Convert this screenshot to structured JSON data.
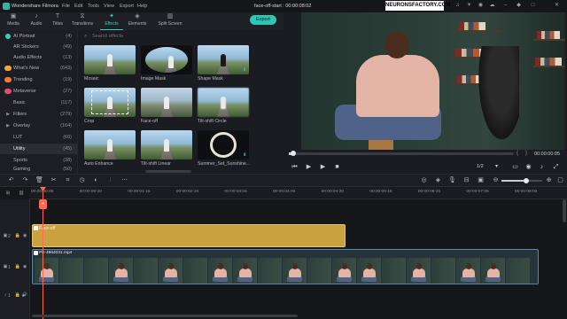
{
  "app": {
    "name": "Wondershare Filmora",
    "project_title": "face-off-start : 00:00:08:02",
    "menu": [
      "File",
      "Edit",
      "Tools",
      "View",
      "Export",
      "Help"
    ],
    "accent_color": "#2fd3c2"
  },
  "watermark": "NEURONSFACTORY.COM",
  "brand_mark": "NEURONS FACTORY",
  "tabs": [
    {
      "label": "Media",
      "icon": "media-icon"
    },
    {
      "label": "Audio",
      "icon": "audio-icon"
    },
    {
      "label": "Titles",
      "icon": "titles-icon"
    },
    {
      "label": "Transitions",
      "icon": "transitions-icon"
    },
    {
      "label": "Effects",
      "icon": "effects-icon",
      "active": true
    },
    {
      "label": "Elements",
      "icon": "elements-icon"
    },
    {
      "label": "Split Screen",
      "icon": "split-screen-icon"
    }
  ],
  "export_label": "Export",
  "sidebar": {
    "items": [
      {
        "label": "AI Portrait",
        "count": "(4)"
      },
      {
        "label": "AR Stickers",
        "count": "(49)"
      },
      {
        "label": "Audio Effects",
        "count": "(13)"
      },
      {
        "label": "What's New",
        "count": "(643)"
      },
      {
        "label": "Trending",
        "count": "(19)"
      },
      {
        "label": "Metaverse",
        "count": "(27)"
      },
      {
        "label": "Basic",
        "count": "(117)"
      },
      {
        "label": "Filters",
        "count": "(279)"
      },
      {
        "label": "Overlay",
        "count": "(164)"
      },
      {
        "label": "LUT",
        "count": "(66)"
      },
      {
        "label": "Utility",
        "count": "(45)",
        "selected": true
      },
      {
        "label": "Sports",
        "count": "(38)"
      },
      {
        "label": "Gaming",
        "count": "(50)"
      }
    ]
  },
  "search": {
    "placeholder": "Search effects"
  },
  "effects": [
    {
      "label": "Mosaic"
    },
    {
      "label": "Image Mask"
    },
    {
      "label": "Shape Mask"
    },
    {
      "label": "Crop"
    },
    {
      "label": "Face-off"
    },
    {
      "label": "Tilt-shift Circle"
    },
    {
      "label": "Auto Enhance"
    },
    {
      "label": "Tilt-shift Linear"
    },
    {
      "label": "Summer_Set_Sunshine..."
    }
  ],
  "preview": {
    "timecode": "00:00:00:05",
    "page_indicator": "1/2",
    "playback_progress": 0.02
  },
  "timeline": {
    "ruler_labels": [
      "00:00:00:00",
      "00:00:00:20",
      "00:00:01:15",
      "00:00:02:10",
      "00:00:03:05",
      "00:00:04:00",
      "00:00:04:20",
      "00:00:05:15",
      "00:00:06:10",
      "00:00:07:05",
      "00:00:08:00"
    ],
    "effect_clip_label": "Face-off",
    "video_clip_label": "PE-4964031.mp4",
    "track_labels": [
      "2",
      "1",
      "1"
    ],
    "zoom_level": 0.6
  }
}
